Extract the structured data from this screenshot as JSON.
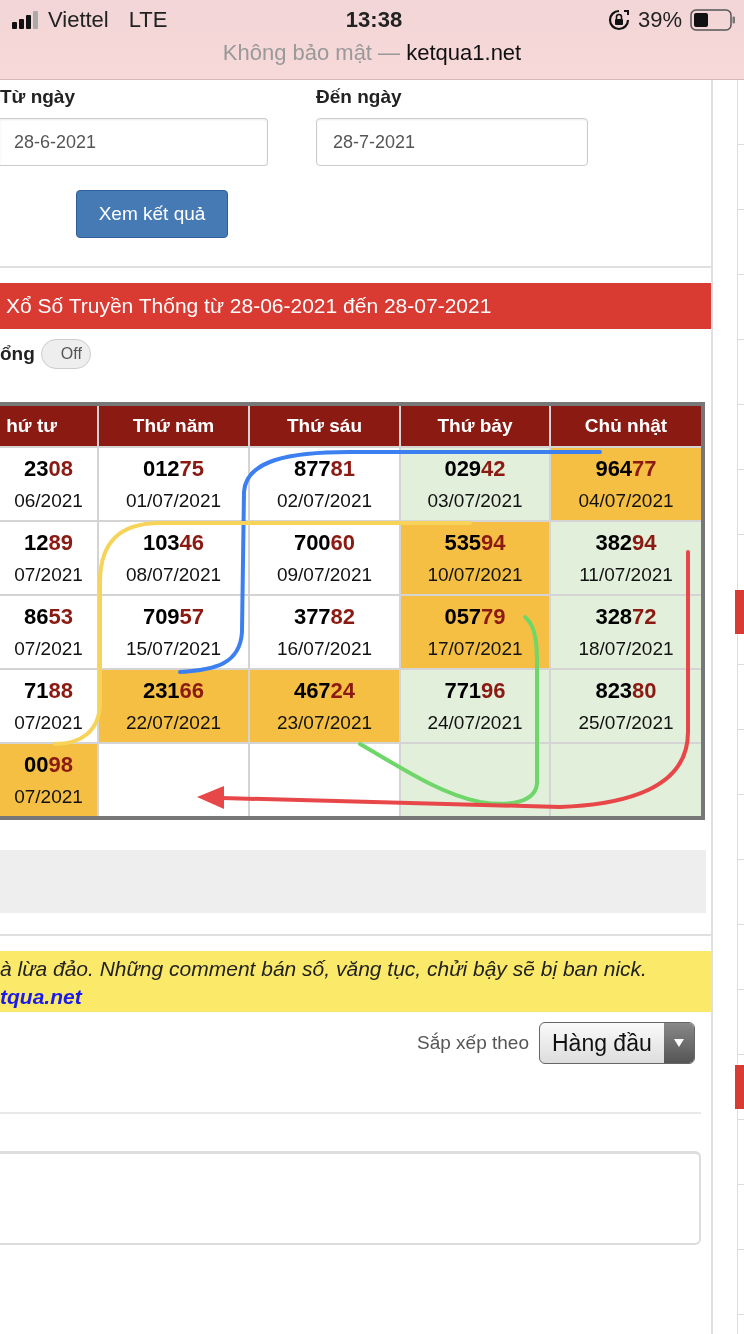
{
  "status_bar": {
    "carrier": "Viettel",
    "network": "LTE",
    "time": "13:38",
    "battery": "39%"
  },
  "address_bar": {
    "security": "Không bảo mật —",
    "domain": "ketqua1.net"
  },
  "date_form": {
    "from_label": "Từ ngày",
    "from_value": "28-6-2021",
    "to_label": "Đến ngày",
    "to_value": "28-7-2021",
    "submit": "Xem kết quả"
  },
  "results": {
    "title": "Xổ Số Truyền Thống từ 28-06-2021 đến 28-07-2021",
    "toggle": {
      "label": "ổng",
      "on": false,
      "text": "Off"
    },
    "columns": [
      {
        "label": "hứ tư",
        "weekend": false
      },
      {
        "label": "Thứ năm",
        "weekend": false
      },
      {
        "label": "Thứ sáu",
        "weekend": false
      },
      {
        "label": "Thứ bảy",
        "weekend": true
      },
      {
        "label": "Chủ nhật",
        "weekend": true
      }
    ],
    "rows": [
      {
        "cells": [
          {
            "kind": "result",
            "number": "23",
            "tail": "08",
            "date": "06/2021",
            "highlighted": false
          },
          {
            "kind": "result",
            "number": "012",
            "tail": "75",
            "date": "01/07/2021",
            "highlighted": false
          },
          {
            "kind": "result",
            "number": "877",
            "tail": "81",
            "date": "02/07/2021",
            "highlighted": false
          },
          {
            "kind": "result",
            "number": "029",
            "tail": "42",
            "date": "03/07/2021",
            "highlighted": false
          },
          {
            "kind": "result",
            "number": "964",
            "tail": "77",
            "date": "04/07/2021",
            "highlighted": true
          }
        ]
      },
      {
        "cells": [
          {
            "kind": "result",
            "number": "12",
            "tail": "89",
            "date": "07/2021",
            "highlighted": false
          },
          {
            "kind": "result",
            "number": "103",
            "tail": "46",
            "date": "08/07/2021",
            "highlighted": false
          },
          {
            "kind": "result",
            "number": "700",
            "tail": "60",
            "date": "09/07/2021",
            "highlighted": false
          },
          {
            "kind": "result",
            "number": "535",
            "tail": "94",
            "date": "10/07/2021",
            "highlighted": true
          },
          {
            "kind": "result",
            "number": "382",
            "tail": "94",
            "date": "11/07/2021",
            "highlighted": false
          }
        ]
      },
      {
        "cells": [
          {
            "kind": "result",
            "number": "86",
            "tail": "53",
            "date": "07/2021",
            "highlighted": false
          },
          {
            "kind": "result",
            "number": "709",
            "tail": "57",
            "date": "15/07/2021",
            "highlighted": false
          },
          {
            "kind": "result",
            "number": "377",
            "tail": "82",
            "date": "16/07/2021",
            "highlighted": false
          },
          {
            "kind": "result",
            "number": "057",
            "tail": "79",
            "date": "17/07/2021",
            "highlighted": true
          },
          {
            "kind": "result",
            "number": "328",
            "tail": "72",
            "date": "18/07/2021",
            "highlighted": false
          }
        ]
      },
      {
        "cells": [
          {
            "kind": "result",
            "number": "71",
            "tail": "88",
            "date": "07/2021",
            "highlighted": false
          },
          {
            "kind": "result",
            "number": "231",
            "tail": "66",
            "date": "22/07/2021",
            "highlighted": true
          },
          {
            "kind": "result",
            "number": "467",
            "tail": "24",
            "date": "23/07/2021",
            "highlighted": true
          },
          {
            "kind": "result",
            "number": "771",
            "tail": "96",
            "date": "24/07/2021",
            "highlighted": false
          },
          {
            "kind": "result",
            "number": "823",
            "tail": "80",
            "date": "25/07/2021",
            "highlighted": false
          }
        ]
      },
      {
        "cells": [
          {
            "kind": "result",
            "number": "00",
            "tail": "98",
            "date": "07/2021",
            "highlighted": true
          },
          {
            "kind": "empty"
          },
          {
            "kind": "empty"
          },
          {
            "kind": "empty"
          },
          {
            "kind": "empty"
          }
        ]
      }
    ]
  },
  "notice": {
    "text": "à lừa đảo. Những comment bán số, văng tục, chửi bậy sẽ bị ban nick.",
    "link": "tqua.net"
  },
  "comments": {
    "sort_label": "Sắp xếp theo",
    "sort_value": "Hàng đầu"
  }
}
